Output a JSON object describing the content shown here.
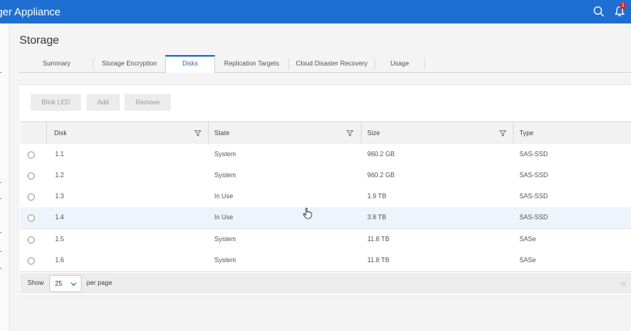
{
  "header": {
    "app_title": "ger Appliance",
    "icons": {
      "search": "search-icon",
      "notifications": "bell-icon"
    },
    "notification_count": "1",
    "colors": {
      "bar": "#1e6fd1",
      "badge": "#e02424"
    }
  },
  "page": {
    "title": "Storage"
  },
  "tabs": [
    {
      "label": "Summary",
      "active": false
    },
    {
      "label": "Storage Encryption",
      "active": false
    },
    {
      "label": "Disks",
      "active": true
    },
    {
      "label": "Replication Targets",
      "active": false
    },
    {
      "label": "Cloud Disaster Recovery",
      "active": false
    },
    {
      "label": "Usage",
      "active": false
    }
  ],
  "toolbar": {
    "blink_led_label": "Blink LED",
    "add_label": "Add",
    "remove_label": "Remove"
  },
  "table": {
    "columns": [
      "Disk",
      "State",
      "Size",
      "Type"
    ],
    "rows": [
      {
        "disk": "1.1",
        "state": "System",
        "size": "960.2 GB",
        "type": "SAS-SSD"
      },
      {
        "disk": "1.2",
        "state": "System",
        "size": "960.2 GB",
        "type": "SAS-SSD"
      },
      {
        "disk": "1.3",
        "state": "In Use",
        "size": "1.9 TB",
        "type": "SAS-SSD"
      },
      {
        "disk": "1.4",
        "state": "In Use",
        "size": "3.8 TB",
        "type": "SAS-SSD"
      },
      {
        "disk": "1.5",
        "state": "System",
        "size": "11.8 TB",
        "type": "SASe"
      },
      {
        "disk": "1.6",
        "state": "System",
        "size": "11.8 TB",
        "type": "SASe"
      }
    ]
  },
  "pagination": {
    "show_label": "Show",
    "page_size": "25",
    "per_page_label": "per page"
  }
}
